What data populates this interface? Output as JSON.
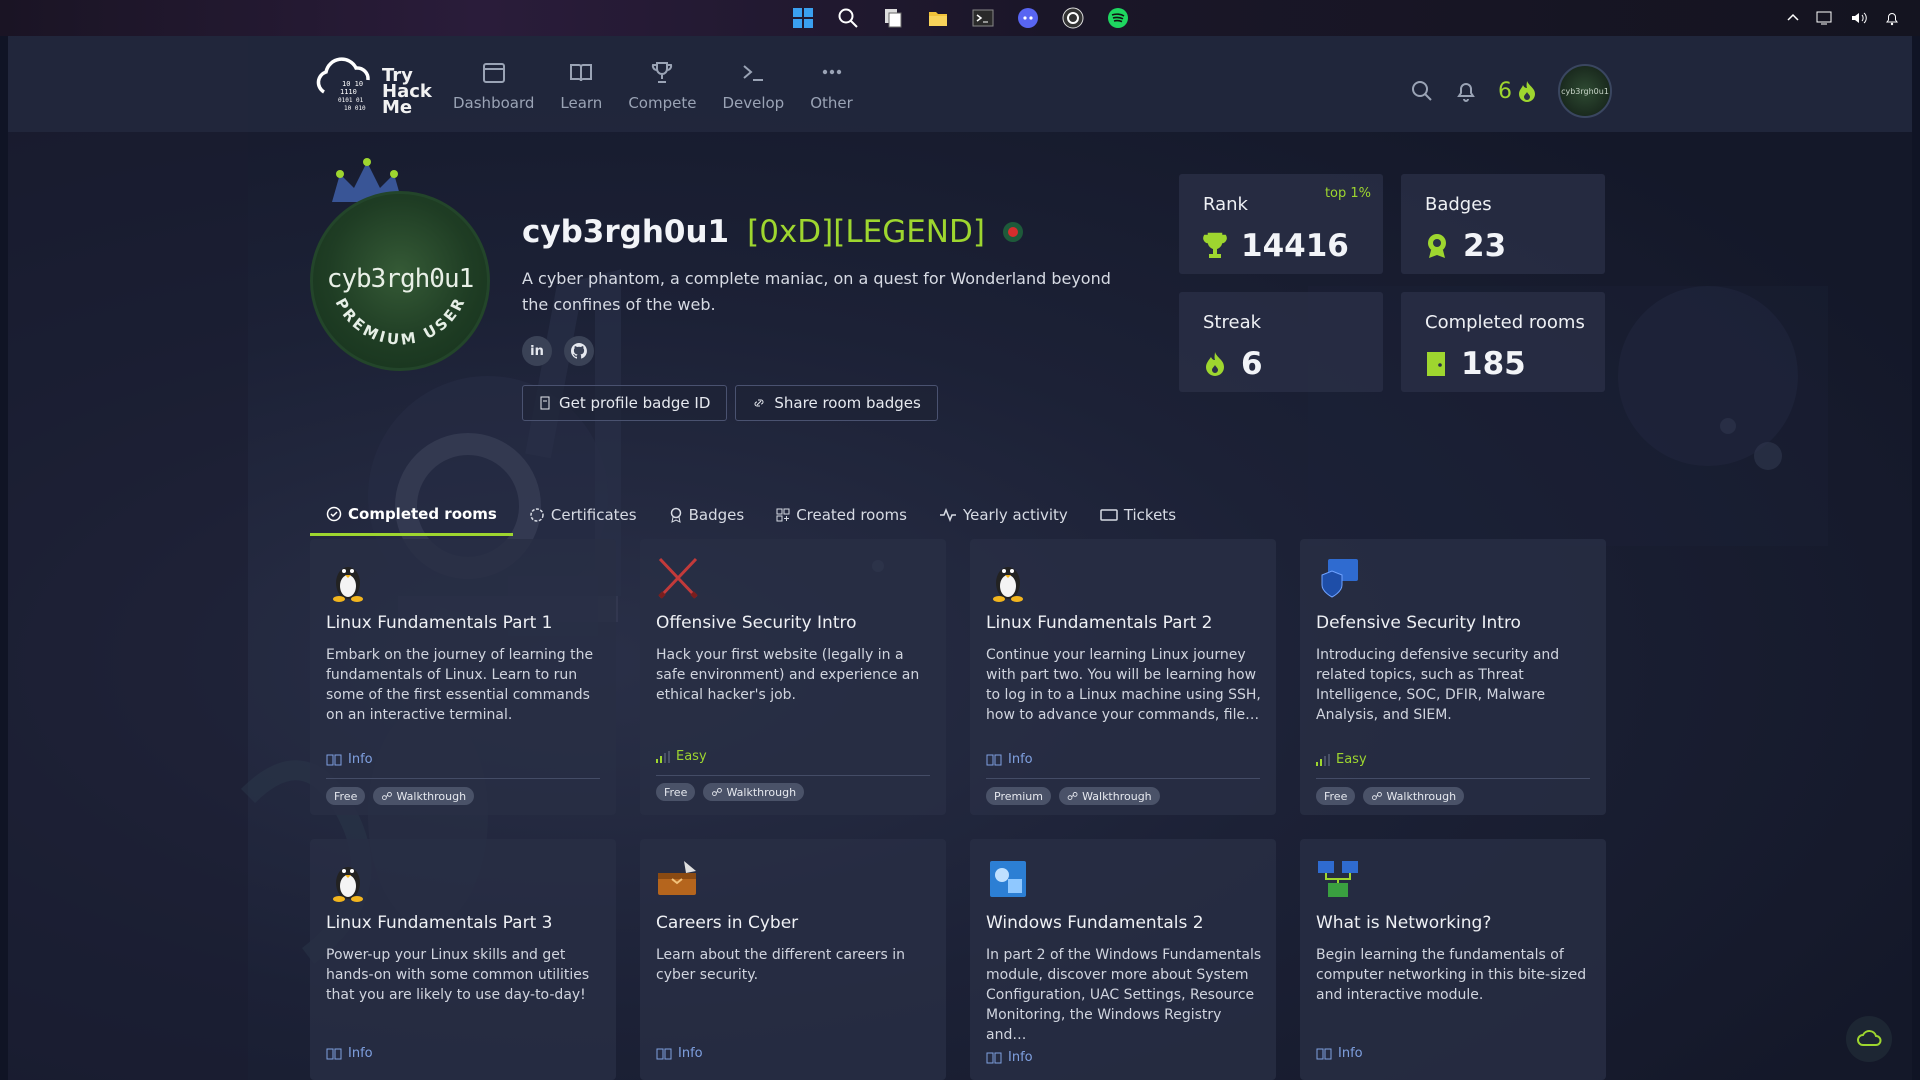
{
  "taskbar": {
    "center_icons": [
      "windows-start-icon",
      "search-icon",
      "task-view-icon",
      "file-explorer-icon",
      "terminal-icon",
      "discord-icon",
      "obs-icon",
      "spotify-icon"
    ],
    "tray_icons": [
      "chevron-up-icon",
      "display-icon",
      "volume-icon",
      "bell-icon"
    ]
  },
  "header": {
    "logo_text": [
      "Try",
      "Hack",
      "Me"
    ],
    "logo_binary": [
      "10 10",
      "1110",
      "0101 01",
      "10 010"
    ],
    "nav": [
      {
        "label": "Dashboard",
        "icon": "dashboard-icon"
      },
      {
        "label": "Learn",
        "icon": "book-icon"
      },
      {
        "label": "Compete",
        "icon": "trophy-icon"
      },
      {
        "label": "Develop",
        "icon": "terminal-prompt-icon"
      },
      {
        "label": "Other",
        "icon": "more-icon"
      }
    ],
    "streak": "6",
    "avatar_text": "cyb3rgh0u1"
  },
  "profile": {
    "avatar_text": "cyb3rgh0u1",
    "ring_text": "PREMIUM USER",
    "username": "cyb3rgh0u1",
    "rank_title": "[0xD][LEGEND]",
    "bio": "A cyber phantom, a complete maniac, on a quest for Wonderland beyond the confines of the web.",
    "socials": [
      {
        "label": "in",
        "icon": "linkedin-icon"
      },
      {
        "label": "",
        "icon": "github-icon"
      }
    ],
    "actions": [
      "Get profile badge ID",
      "Share room badges"
    ]
  },
  "stats": [
    {
      "label": "Rank",
      "value": "14416",
      "tag": "top 1%",
      "icon": "trophy-icon"
    },
    {
      "label": "Badges",
      "value": "23",
      "tag": "",
      "icon": "badge-icon"
    },
    {
      "label": "Streak",
      "value": "6",
      "tag": "",
      "icon": "flame-icon"
    },
    {
      "label": "Completed rooms",
      "value": "185",
      "tag": "",
      "icon": "door-icon"
    }
  ],
  "tabs": [
    {
      "label": "Completed rooms",
      "active": true
    },
    {
      "label": "Certificates"
    },
    {
      "label": "Badges"
    },
    {
      "label": "Created rooms"
    },
    {
      "label": "Yearly activity"
    },
    {
      "label": "Tickets"
    }
  ],
  "cards": [
    {
      "title": "Linux Fundamentals Part 1",
      "desc": "Embark on the journey of learning the fundamentals of Linux. Learn to run some of the first essential commands on an interactive terminal.",
      "meta": "Info",
      "chips": [
        "Free",
        "Walkthrough"
      ],
      "icon": "linux-penguin-icon"
    },
    {
      "title": "Offensive Security Intro",
      "desc": "Hack your first website (legally in a safe environment) and experience an ethical hacker's job.",
      "meta": "Easy",
      "chips": [
        "Free",
        "Walkthrough"
      ],
      "icon": "crossed-swords-icon"
    },
    {
      "title": "Linux Fundamentals Part 2",
      "desc": "Continue your learning Linux journey with part two. You will be learning how to log in to a Linux machine using SSH, how to advance your commands, file…",
      "meta": "Info",
      "chips": [
        "Premium",
        "Walkthrough"
      ],
      "icon": "linux-penguin-icon"
    },
    {
      "title": "Defensive Security Intro",
      "desc": "Introducing defensive security and related topics, such as Threat Intelligence, SOC, DFIR, Malware Analysis, and SIEM.",
      "meta": "Easy",
      "chips": [
        "Free",
        "Walkthrough"
      ],
      "icon": "shield-monitor-icon"
    },
    {
      "title": "Linux Fundamentals Part 3",
      "desc": "Power-up your Linux skills and get hands-on with some common utilities that you are likely to use day-to-day!",
      "meta": "Info",
      "chips": [],
      "icon": "linux-penguin-icon"
    },
    {
      "title": "Careers in Cyber",
      "desc": "Learn about the different careers in cyber security.",
      "meta": "Info",
      "chips": [],
      "icon": "briefcase-icon"
    },
    {
      "title": "Windows Fundamentals 2",
      "desc": "In part 2 of the Windows Fundamentals module, discover more about System Configuration, UAC Settings, Resource Monitoring, the Windows Registry and…",
      "meta": "Info",
      "chips": [],
      "icon": "windows-logo-icon"
    },
    {
      "title": "What is Networking?",
      "desc": "Begin learning the fundamentals of computer networking in this bite-sized and interactive module.",
      "meta": "Info",
      "chips": [],
      "icon": "network-icon"
    }
  ],
  "colors": {
    "accent": "#9ed62f",
    "info": "#7fa0e0",
    "bg": "#1c2136",
    "card": "#282e44"
  }
}
